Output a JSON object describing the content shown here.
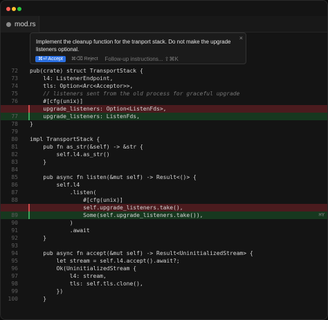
{
  "tab": {
    "label": "mod.rs",
    "icon": "rust-file-icon"
  },
  "prompt": {
    "text": "Implement the cleanup function for the tranport stack. Do not make the upgrade listeners optional.",
    "accept_label": "⌘⏎ Accept",
    "reject_label": "⌘⌫ Reject",
    "followup_placeholder": "Follow-up instructions... ⇧⌘K",
    "close_label": "×"
  },
  "editor": {
    "add_hint": "⌘Y"
  },
  "code": [
    {
      "ln": "72",
      "text": "pub(crate) struct TransportStack {",
      "kind": "normal"
    },
    {
      "ln": "73",
      "text": "    l4: ListenerEndpoint,",
      "kind": "normal"
    },
    {
      "ln": "74",
      "text": "    tls: Option<Arc<Acceptor>>,",
      "kind": "normal"
    },
    {
      "ln": "75",
      "text": "    // listeners sent from the old process for graceful upgrade",
      "kind": "comment"
    },
    {
      "ln": "76",
      "text": "    #[cfg(unix)]",
      "kind": "normal"
    },
    {
      "ln": "",
      "text": "    upgrade_listeners: Option<ListenFds>,",
      "kind": "del"
    },
    {
      "ln": "77",
      "text": "    upgrade_listeners: ListenFds,",
      "kind": "add"
    },
    {
      "ln": "78",
      "text": "}",
      "kind": "normal"
    },
    {
      "ln": "79",
      "text": "",
      "kind": "normal"
    },
    {
      "ln": "80",
      "text": "impl TransportStack {",
      "kind": "normal"
    },
    {
      "ln": "81",
      "text": "    pub fn as_str(&self) -> &str {",
      "kind": "normal"
    },
    {
      "ln": "82",
      "text": "        self.l4.as_str()",
      "kind": "normal"
    },
    {
      "ln": "83",
      "text": "    }",
      "kind": "normal"
    },
    {
      "ln": "84",
      "text": "",
      "kind": "normal"
    },
    {
      "ln": "85",
      "text": "    pub async fn listen(&mut self) -> Result<()> {",
      "kind": "normal"
    },
    {
      "ln": "86",
      "text": "        self.l4",
      "kind": "normal"
    },
    {
      "ln": "87",
      "text": "            .listen(",
      "kind": "normal"
    },
    {
      "ln": "88",
      "text": "                #[cfg(unix)]",
      "kind": "normal"
    },
    {
      "ln": "",
      "text": "                self.upgrade_listeners.take(),",
      "kind": "del"
    },
    {
      "ln": "89",
      "text": "                Some(self.upgrade_listeners.take()),",
      "kind": "add"
    },
    {
      "ln": "90",
      "text": "            )",
      "kind": "normal"
    },
    {
      "ln": "91",
      "text": "            .await",
      "kind": "normal"
    },
    {
      "ln": "92",
      "text": "    }",
      "kind": "normal"
    },
    {
      "ln": "93",
      "text": "",
      "kind": "normal"
    },
    {
      "ln": "94",
      "text": "    pub async fn accept(&mut self) -> Result<UninitializedStream> {",
      "kind": "normal"
    },
    {
      "ln": "95",
      "text": "        let stream = self.l4.accept().await?;",
      "kind": "normal"
    },
    {
      "ln": "96",
      "text": "        Ok(UninitializedStream {",
      "kind": "normal"
    },
    {
      "ln": "97",
      "text": "            l4: stream,",
      "kind": "normal"
    },
    {
      "ln": "98",
      "text": "            tls: self.tls.clone(),",
      "kind": "normal"
    },
    {
      "ln": "99",
      "text": "        })",
      "kind": "normal"
    },
    {
      "ln": "100",
      "text": "    }",
      "kind": "normal"
    }
  ],
  "colors": {
    "background": "#141414",
    "accept_button": "#2b6fe0",
    "deleted_line": "#4b1b1e",
    "added_line": "#17381f",
    "keyword": "#d6c06a"
  }
}
